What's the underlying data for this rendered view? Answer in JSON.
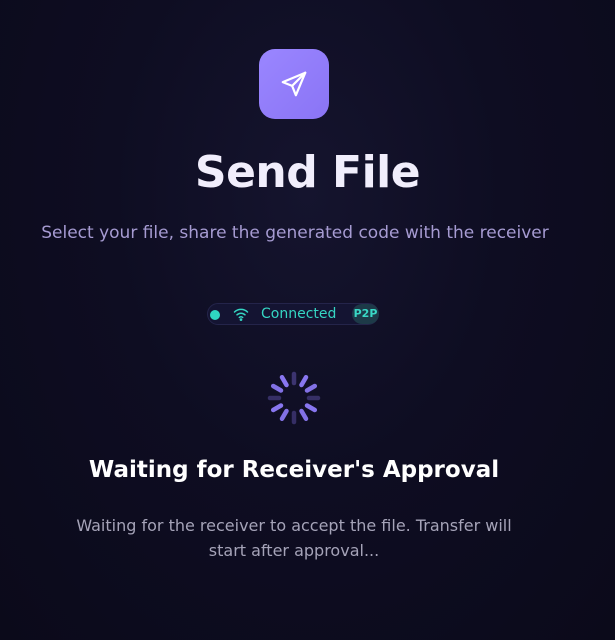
{
  "header": {
    "icon": "send-paper-plane-icon",
    "title": "Send File",
    "subtitle": "Select your file, share the generated code with the receiver"
  },
  "connection": {
    "status_label": "Connected",
    "mode_badge": "P2P",
    "icon": "wifi-icon",
    "status_color": "#2fd6c2"
  },
  "progress": {
    "icon": "loading-spinner-icon",
    "heading": "Waiting for Receiver's Approval",
    "description": "Waiting for the receiver to accept the file. Transfer will start after approval..."
  },
  "colors": {
    "accent": "#8f7cfb",
    "background": "#0e0d22",
    "connected": "#35d6c3"
  }
}
